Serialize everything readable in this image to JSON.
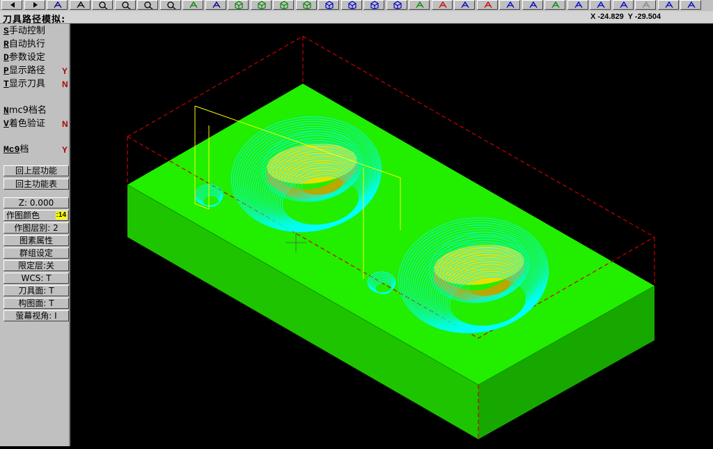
{
  "toolbar": {
    "icons": [
      "arrow-left-icon",
      "arrow-right-icon",
      "help-icon",
      "cursor-help-icon",
      "zoom-in-icon",
      "zoom-out-icon",
      "zoom-window-icon",
      "zoom-prev-icon",
      "pan-icon",
      "repaint-icon",
      "view-cube-1-icon",
      "view-cube-2-icon",
      "view-cube-3-icon",
      "view-cube-4-icon",
      "view-cube-5-icon",
      "view-cube-6-icon",
      "view-cube-7-icon",
      "view-cube-8-icon",
      "edit-icon",
      "delete-icon",
      "toolpath-icon",
      "toolpath-2-icon",
      "undo-icon",
      "sphere-icon",
      "layer-icon",
      "z-icon",
      "line-icon",
      "point-icon",
      "close-x-icon",
      "arc-icon",
      "window-icon"
    ]
  },
  "title": "刀具路径模拟:",
  "coordinates": "X -24.829  Y -29.504",
  "menu": {
    "items": [
      {
        "key": "S",
        "label": "手动控制",
        "flag": ""
      },
      {
        "key": "R",
        "label": "自动执行",
        "flag": ""
      },
      {
        "key": "D",
        "label": "参数设定",
        "flag": ""
      },
      {
        "key": "P",
        "label": "显示路径",
        "flag": "Y"
      },
      {
        "key": "T",
        "label": "显示刀具",
        "flag": "N"
      },
      {
        "key": "N",
        "label": "mc9档名",
        "flag": ""
      },
      {
        "key": "V",
        "label": "着色验证",
        "flag": "N"
      },
      {
        "key": "Mc9",
        "label": "档",
        "flag": "Y"
      }
    ],
    "back_upper": "回上层功能",
    "back_main": "回主功能表",
    "z_value": "Z:  0.000",
    "draw_color_label": "作图颜色",
    "draw_color_value": ":14",
    "draw_layer": "作图层别:  2",
    "entity_attr": "图素属性",
    "group_settings": "群组设定",
    "limit_layer": "限定层:关",
    "wcs": "WCS:   T",
    "tool_plane": "刀具面:  T",
    "cplane": "构图面:  T",
    "screen_view": "萤幕视角:  I"
  },
  "viewport": {
    "colors": {
      "background": "#000000",
      "stock_top": "#22ee00",
      "stock_side": "#1ec400",
      "toolpath": "#00ffff",
      "part": "#e8e000",
      "bbox": "#cc0000"
    }
  }
}
